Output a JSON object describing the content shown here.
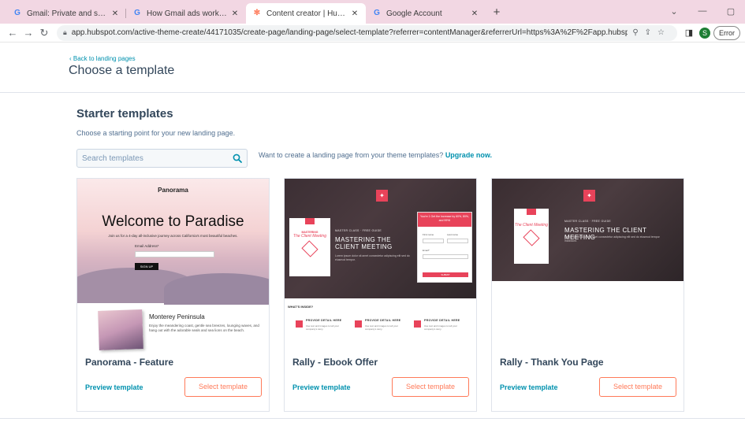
{
  "browser": {
    "tabs": [
      {
        "title": "Gmail: Private and secure email",
        "favicon": "G",
        "active": false
      },
      {
        "title": "How Gmail ads work - Gmail Help",
        "favicon": "G",
        "active": false
      },
      {
        "title": "Content creator | HubSpot",
        "favicon": "hubspot-sprocket",
        "active": true
      },
      {
        "title": "Google Account",
        "favicon": "G",
        "active": false
      }
    ],
    "url": "app.hubspot.com/active-theme-create/44171035/create-page/landing-page/select-template?referrer=contentManager&referrerUrl=https%3A%2F%2Fapp.hubspot.com%2Fwebsite%2...",
    "profile_initial": "S",
    "error_label": "Error"
  },
  "page": {
    "back_link": "‹ Back to landing pages",
    "title": "Choose a template",
    "section_title": "Starter templates",
    "section_subtitle": "Choose a starting point for your new landing page.",
    "search_placeholder": "Search templates",
    "upgrade_text": "Want to create a landing page from your theme templates?",
    "upgrade_link": "Upgrade now."
  },
  "templates": [
    {
      "name": "Panorama - Feature",
      "preview_label": "Preview template",
      "select_label": "Select template",
      "thumb": {
        "brand": "Panorama",
        "headline": "Welcome to Paradise",
        "subline": "Join us for a 4-day all-inclusive journey across California's most beautiful beaches.",
        "email_label": "Email Address*",
        "button": "SIGN UP",
        "feature_title": "Monterey Peninsula",
        "feature_text": "Enjoy the meandering coast, gentle sea breezes, lounging waves, and hang out with the adorable seals and sea lions on the beach."
      }
    },
    {
      "name": "Rally - Ebook Offer",
      "preview_label": "Preview template",
      "select_label": "Select template",
      "thumb": {
        "kicker": "MASTER CLASS · FREE GUIDE",
        "title": "MASTERING THE CLIENT MEETING",
        "ebook_small": "MASTERING",
        "ebook_title": "The Client Meeting",
        "form_head": "You're 1 Get the Increase by 60%, 80%, and 99%!",
        "first_name": "First name",
        "last_name": "Last name",
        "email": "Email*",
        "submit": "SUBMIT",
        "inside": "WHAT'S INSIDE?",
        "detail": "PROVIDE DETAIL HERE"
      }
    },
    {
      "name": "Rally - Thank You Page",
      "preview_label": "Preview template",
      "select_label": "Select template",
      "thumb": {
        "kicker": "MASTER CLASS · FREE GUIDE",
        "title": "MASTERING THE CLIENT MEETING",
        "ebook_title": "The Client Meeting"
      }
    }
  ],
  "colors": {
    "accent": "#ff7a59",
    "link": "#0091ae",
    "text": "#33475b",
    "rally_red": "#e8435a",
    "tab_strip": "#f2d7e3"
  }
}
